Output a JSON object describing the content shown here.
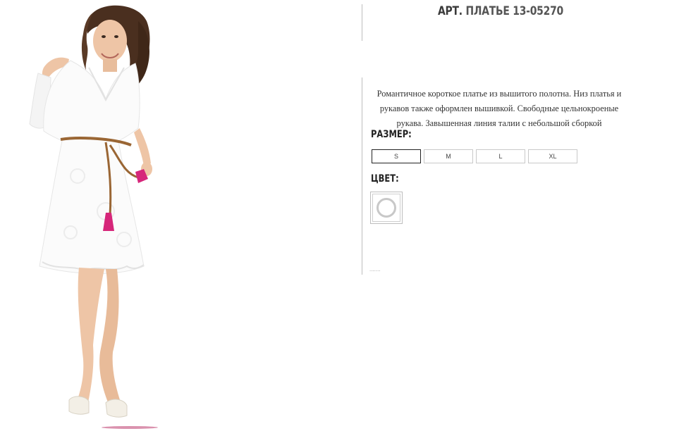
{
  "product": {
    "article_prefix": "АРТ.",
    "article_name": "ПЛАТЬЕ 13-05270",
    "description": "Романтичное короткое платье из вышитого полотна. Низ платья и рукавов также оформлен вышивкой. Свободные цельнокроеные рукава. Завышенная линия талии с небольшой сборкой"
  },
  "size": {
    "label": "РАЗМЕР:",
    "options": [
      "S",
      "M",
      "L",
      "XL"
    ],
    "selected": "S"
  },
  "color": {
    "label": "ЦВЕТ:",
    "swatches": [
      {
        "name": "white",
        "hex": "#ffffff",
        "selected": true
      }
    ]
  },
  "footer": {
    "dots": "......."
  },
  "photo": {
    "icon": "product-photo",
    "dress_color": "#ffffff",
    "belt_color": "#8b5a2b",
    "tassel_color": "#d6267a"
  }
}
